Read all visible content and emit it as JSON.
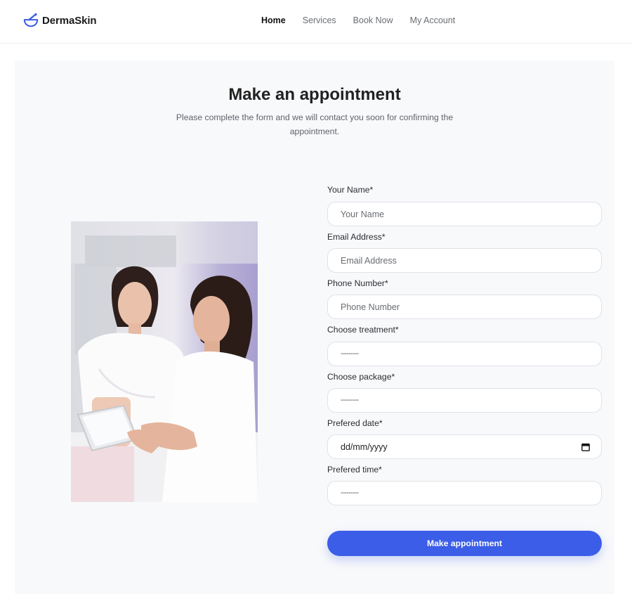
{
  "brand": {
    "name": "DermaSkin",
    "icon": "mortar-pestle-icon",
    "color": "#3b5de7"
  },
  "nav": {
    "items": [
      {
        "label": "Home",
        "active": true
      },
      {
        "label": "Services",
        "active": false
      },
      {
        "label": "Book Now",
        "active": false
      },
      {
        "label": "My Account",
        "active": false
      }
    ]
  },
  "hero": {
    "title": "Make an appointment",
    "subtitle": "Please complete the form and we will contact you soon for confirming the appointment."
  },
  "photo": {
    "subject": "treatment-consultation-photo"
  },
  "form": {
    "name": {
      "label": "Your Name*",
      "placeholder": "Your Name",
      "value": ""
    },
    "email": {
      "label": "Email Address*",
      "placeholder": "Email Address",
      "value": ""
    },
    "phone": {
      "label": "Phone Number*",
      "placeholder": "Phone Number",
      "value": ""
    },
    "treatment": {
      "label": "Choose treatment*",
      "value": "---------"
    },
    "package": {
      "label": "Choose package*",
      "value": "---------"
    },
    "date": {
      "label": "Prefered date*",
      "value": "dd/mm/yyyy",
      "icon": "calendar-icon"
    },
    "time": {
      "label": "Prefered time*",
      "value": "---------"
    },
    "submit_label": "Make appointment"
  },
  "colors": {
    "accent": "#3b5de7",
    "panel": "#f8f9fb",
    "field_border": "#dfe2e7"
  }
}
